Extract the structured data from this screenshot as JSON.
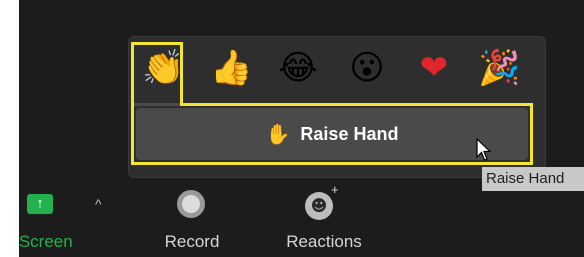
{
  "reactions_popup": {
    "emojis": [
      {
        "name": "clapping-hands",
        "glyph": "👏"
      },
      {
        "name": "thumbs-up",
        "glyph": "👍"
      },
      {
        "name": "tears-of-joy",
        "glyph": "😂"
      },
      {
        "name": "open-mouth",
        "glyph": "😮"
      },
      {
        "name": "red-heart",
        "glyph": "❤"
      },
      {
        "name": "party-popper",
        "glyph": "🎉"
      }
    ],
    "raise_hand": {
      "icon": "✋",
      "label": "Raise Hand"
    },
    "highlight_color": "#f3e633"
  },
  "tooltip": {
    "text": "Raise Hand"
  },
  "toolbar": {
    "share_label": "re Screen",
    "share_icon": "↑",
    "record_label": "Record",
    "reactions_label": "Reactions",
    "accent_color": "#22b14c"
  }
}
